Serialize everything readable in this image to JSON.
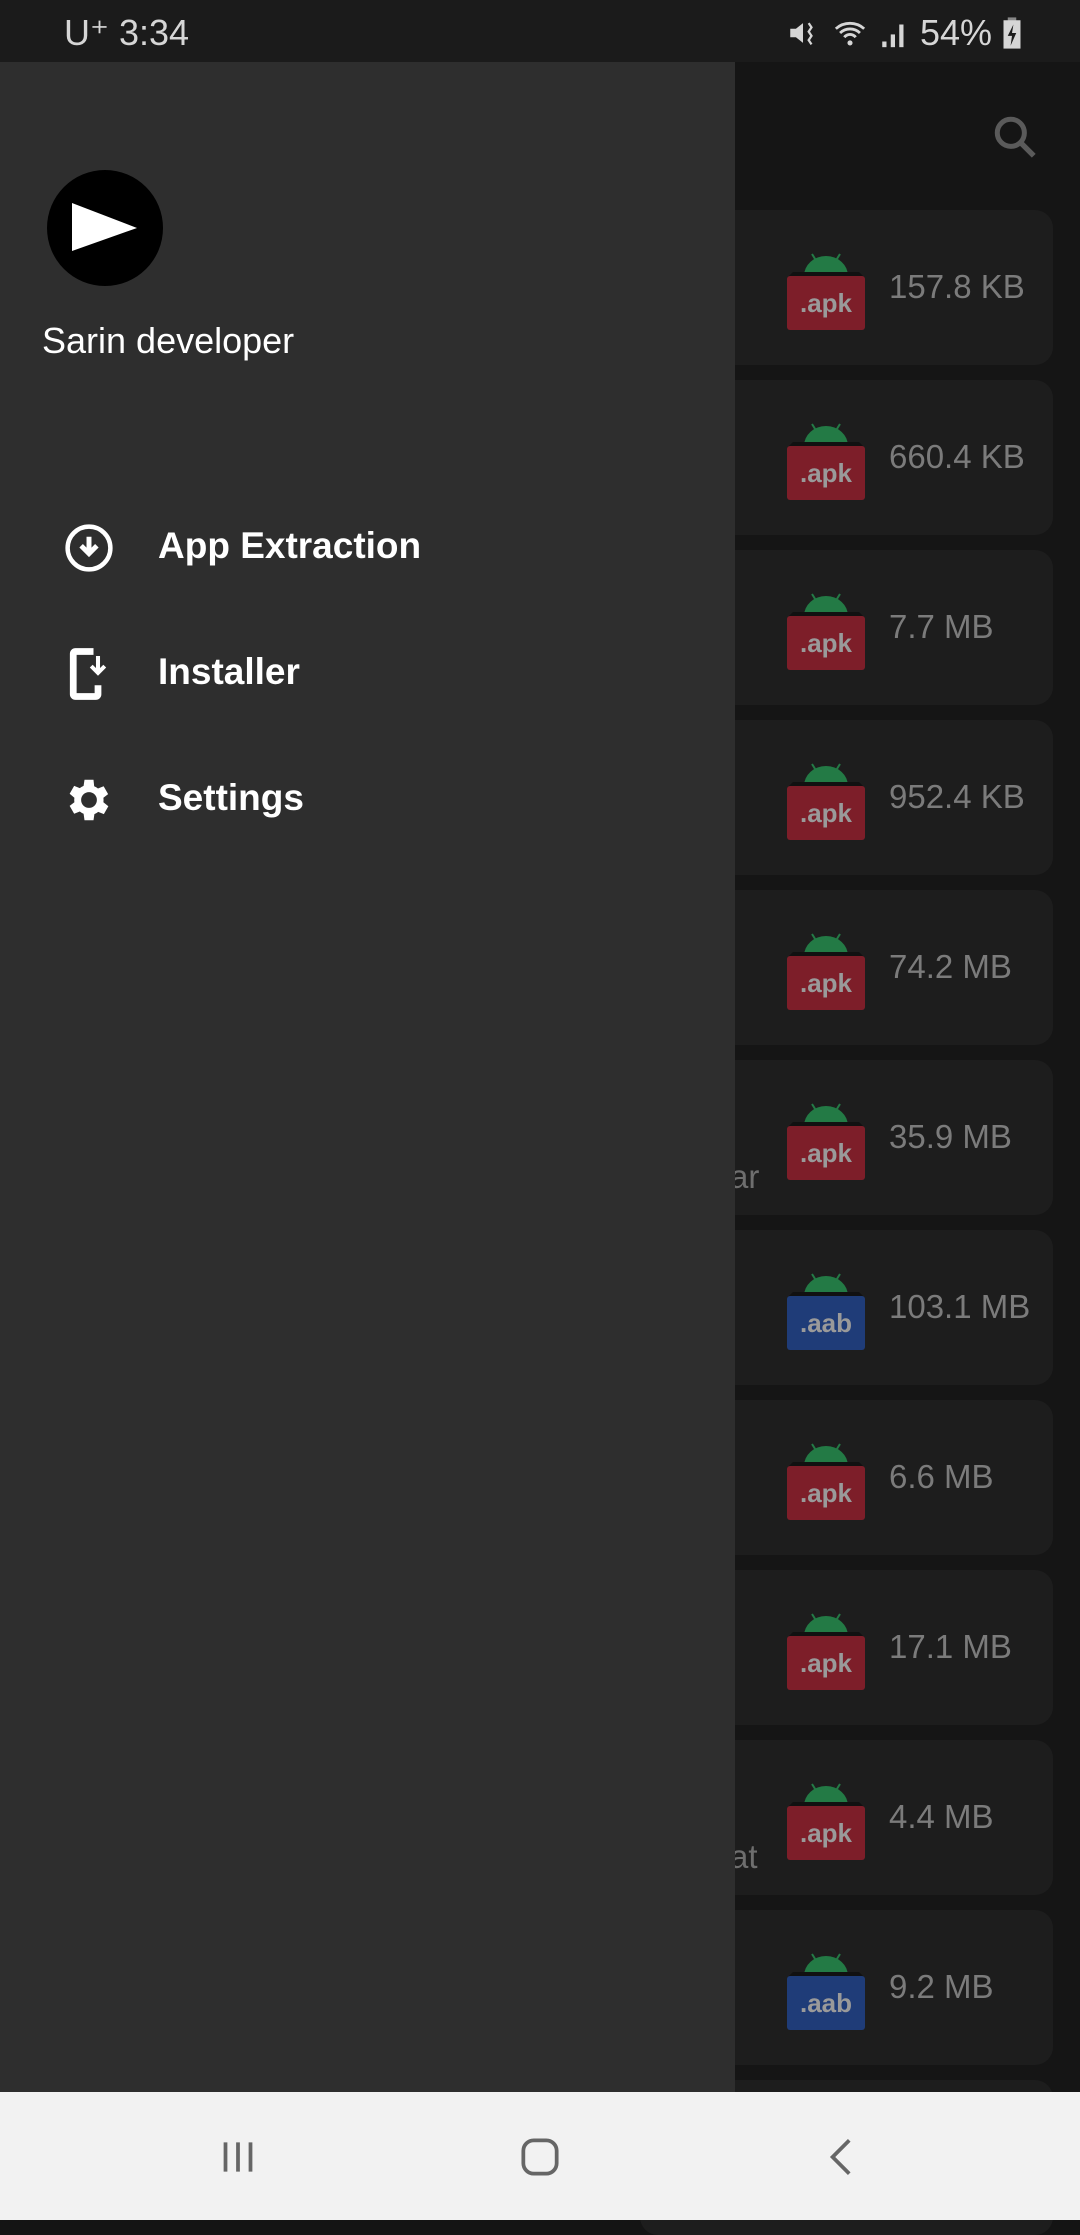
{
  "status_bar": {
    "carrier": "U⁺",
    "time": "3:34",
    "battery": "54%",
    "icons": [
      "mute-icon",
      "wifi-icon",
      "signal-icon",
      "battery-charging-icon"
    ]
  },
  "app_bar": {
    "search_icon": "search-icon"
  },
  "list": {
    "items": [
      {
        "type": ".apk",
        "size": "157.8 KB"
      },
      {
        "type": ".apk",
        "size": "660.4 KB"
      },
      {
        "type": ".apk",
        "size": "7.7 MB"
      },
      {
        "type": ".apk",
        "size": "952.4 KB"
      },
      {
        "type": ".apk",
        "size": "74.2 MB"
      },
      {
        "type": ".apk",
        "size": "35.9 MB",
        "fragment": "ar"
      },
      {
        "type": ".aab",
        "size": "103.1 MB"
      },
      {
        "type": ".apk",
        "size": "6.6 MB"
      },
      {
        "type": ".apk",
        "size": "17.1 MB"
      },
      {
        "type": ".apk",
        "size": "4.4 MB",
        "fragment": "at"
      },
      {
        "type": ".aab",
        "size": "9.2 MB"
      }
    ],
    "colors": {
      "apk": "#7d1e29",
      "aab": "#1f3c78",
      "android": "#237a45"
    }
  },
  "drawer": {
    "user_name": "Sarin developer",
    "items": [
      {
        "label": "App Extraction",
        "icon": "download-circle-icon"
      },
      {
        "label": "Installer",
        "icon": "install-phone-icon"
      },
      {
        "label": "Settings",
        "icon": "gear-icon"
      }
    ]
  },
  "nav_bar": {
    "buttons": [
      "recents-button",
      "home-button",
      "back-button"
    ]
  }
}
